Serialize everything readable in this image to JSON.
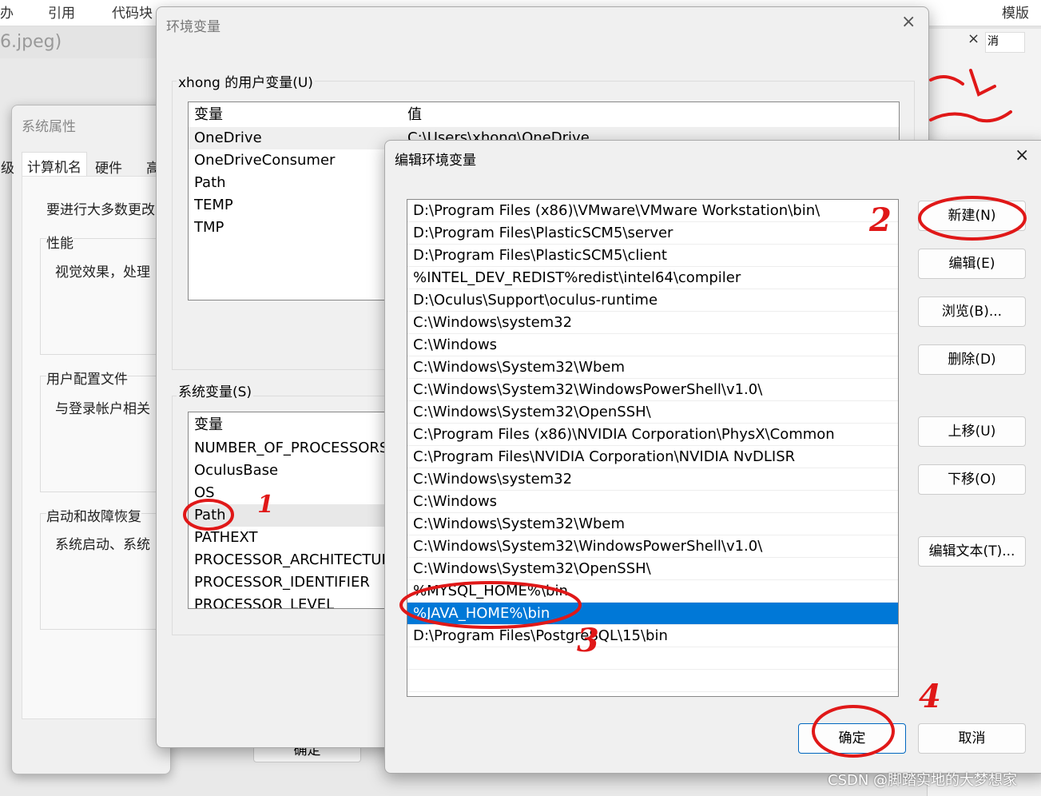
{
  "background": {
    "menu": [
      "办",
      "引用",
      "代码块",
      "模版"
    ],
    "filename": "6.jpeg)",
    "side_close": "×",
    "side_cancel": "消",
    "watermark": "CSDN @脚踏实地的大梦想家"
  },
  "system_properties": {
    "title": "系统属性",
    "tabs": [
      "计算机名",
      "硬件",
      "高"
    ],
    "left_edge": "级",
    "intro": "要进行大多数更改",
    "performance": {
      "label": "性能",
      "text": "视觉效果，处理"
    },
    "profile": {
      "label": "用户配置文件",
      "text": "与登录帐户相关"
    },
    "startup": {
      "label": "启动和故障恢复",
      "text": "系统启动、系统"
    },
    "ok_label": "确定"
  },
  "env_dialog": {
    "title": "环境变量",
    "close": "×",
    "user_vars": {
      "label": "xhong 的用户变量(U)",
      "columns": [
        "变量",
        "值"
      ],
      "rows": [
        {
          "name": "OneDrive",
          "value": "C:\\Users\\xhong\\OneDrive"
        },
        {
          "name": "OneDriveConsumer",
          "value": ""
        },
        {
          "name": "Path",
          "value": ""
        },
        {
          "name": "TEMP",
          "value": ""
        },
        {
          "name": "TMP",
          "value": ""
        }
      ]
    },
    "system_vars": {
      "label": "系统变量(S)",
      "columns": [
        "变量"
      ],
      "rows": [
        "NUMBER_OF_PROCESSORS",
        "OculusBase",
        "OS",
        "Path",
        "PATHEXT",
        "PROCESSOR_ARCHITECTURE",
        "PROCESSOR_IDENTIFIER",
        "PROCESSOR_LEVEL"
      ],
      "selected": "Path"
    }
  },
  "edit_dialog": {
    "title": "编辑环境变量",
    "close": "×",
    "paths": [
      "D:\\Program Files (x86)\\VMware\\VMware Workstation\\bin\\",
      "D:\\Program Files\\PlasticSCM5\\server",
      "D:\\Program Files\\PlasticSCM5\\client",
      "%INTEL_DEV_REDIST%redist\\intel64\\compiler",
      "D:\\Oculus\\Support\\oculus-runtime",
      "C:\\Windows\\system32",
      "C:\\Windows",
      "C:\\Windows\\System32\\Wbem",
      "C:\\Windows\\System32\\WindowsPowerShell\\v1.0\\",
      "C:\\Windows\\System32\\OpenSSH\\",
      "C:\\Program Files (x86)\\NVIDIA Corporation\\PhysX\\Common",
      "C:\\Program Files\\NVIDIA Corporation\\NVIDIA NvDLISR",
      "C:\\Windows\\system32",
      "C:\\Windows",
      "C:\\Windows\\System32\\Wbem",
      "C:\\Windows\\System32\\WindowsPowerShell\\v1.0\\",
      "C:\\Windows\\System32\\OpenSSH\\",
      "%MYSQL_HOME%\\bin",
      "%JAVA_HOME%\\bin",
      "D:\\Program Files\\PostgreSQL\\15\\bin"
    ],
    "selected_index": 18,
    "buttons": {
      "new": "新建(N)",
      "edit": "编辑(E)",
      "browse": "浏览(B)...",
      "delete": "删除(D)",
      "up": "上移(U)",
      "down": "下移(O)",
      "edit_text": "编辑文本(T)...",
      "ok": "确定",
      "cancel": "取消"
    },
    "selection_color": "#0078d7"
  },
  "annotations": {
    "color": "#e01818",
    "steps": [
      "1",
      "2",
      "3",
      "4"
    ]
  }
}
